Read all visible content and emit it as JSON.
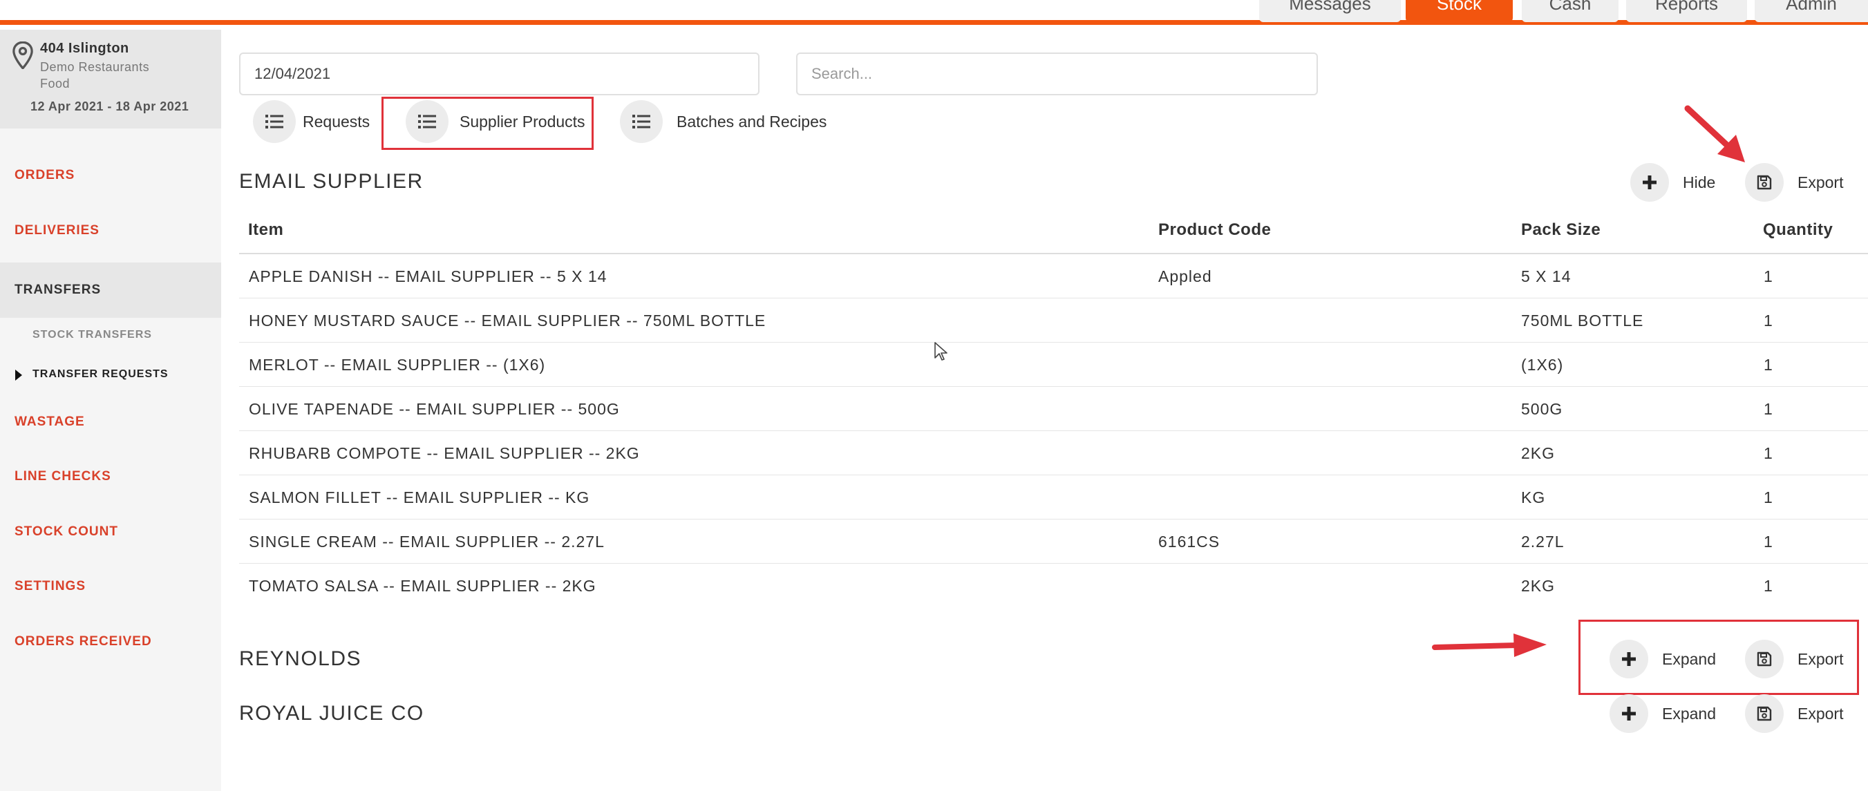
{
  "topnav": {
    "tabs": [
      {
        "label": "Messages",
        "active": false
      },
      {
        "label": "Stock",
        "active": true
      },
      {
        "label": "Cash",
        "active": false
      },
      {
        "label": "Reports",
        "active": false
      },
      {
        "label": "Admin",
        "active": false
      }
    ],
    "accent_color": "#f2550f"
  },
  "sidebar": {
    "location": {
      "name": "404 Islington",
      "company": "Demo Restaurants",
      "category": "Food",
      "date_range": "12 Apr 2021 - 18 Apr 2021"
    },
    "items": [
      {
        "label": "ORDERS"
      },
      {
        "label": "DELIVERIES"
      },
      {
        "label": "TRANSFERS",
        "active": true
      },
      {
        "label": "WASTAGE"
      },
      {
        "label": "LINE CHECKS"
      },
      {
        "label": "STOCK COUNT"
      },
      {
        "label": "SETTINGS"
      },
      {
        "label": "ORDERS RECEIVED"
      }
    ],
    "subitems": [
      {
        "label": "STOCK TRANSFERS"
      },
      {
        "label": "TRANSFER REQUESTS",
        "active": true
      }
    ]
  },
  "filters": {
    "date_value": "12/04/2021",
    "search_placeholder": "Search..."
  },
  "view_tabs": [
    {
      "label": "Requests"
    },
    {
      "label": "Supplier Products",
      "highlighted": true
    },
    {
      "label": "Batches and Recipes"
    }
  ],
  "suppliers": [
    {
      "name": "EMAIL SUPPLIER",
      "toggle_label": "Hide",
      "export_label": "Export",
      "columns": [
        "Item",
        "Product Code",
        "Pack Size",
        "Quantity"
      ],
      "rows": [
        {
          "item": "APPLE DANISH -- EMAIL SUPPLIER -- 5 X 14",
          "code": "Appled",
          "pack": "5 X 14",
          "qty": "1"
        },
        {
          "item": "HONEY MUSTARD SAUCE -- EMAIL SUPPLIER -- 750ML BOTTLE",
          "code": "",
          "pack": "750ML BOTTLE",
          "qty": "1"
        },
        {
          "item": "MERLOT -- EMAIL SUPPLIER -- (1X6)",
          "code": "",
          "pack": "(1X6)",
          "qty": "1"
        },
        {
          "item": "OLIVE TAPENADE -- EMAIL SUPPLIER -- 500G",
          "code": "",
          "pack": "500G",
          "qty": "1"
        },
        {
          "item": "RHUBARB COMPOTE -- EMAIL SUPPLIER -- 2KG",
          "code": "",
          "pack": "2KG",
          "qty": "1"
        },
        {
          "item": "SALMON FILLET -- EMAIL SUPPLIER -- KG",
          "code": "",
          "pack": "KG",
          "qty": "1"
        },
        {
          "item": "SINGLE CREAM -- EMAIL SUPPLIER -- 2.27L",
          "code": "6161CS",
          "pack": "2.27L",
          "qty": "1"
        },
        {
          "item": "TOMATO SALSA -- EMAIL SUPPLIER -- 2KG",
          "code": "",
          "pack": "2KG",
          "qty": "1"
        }
      ]
    },
    {
      "name": "REYNOLDS",
      "toggle_label": "Expand",
      "export_label": "Export"
    },
    {
      "name": "ROYAL JUICE CO",
      "toggle_label": "Expand",
      "export_label": "Export"
    }
  ],
  "annotation_color": "#e0323a"
}
